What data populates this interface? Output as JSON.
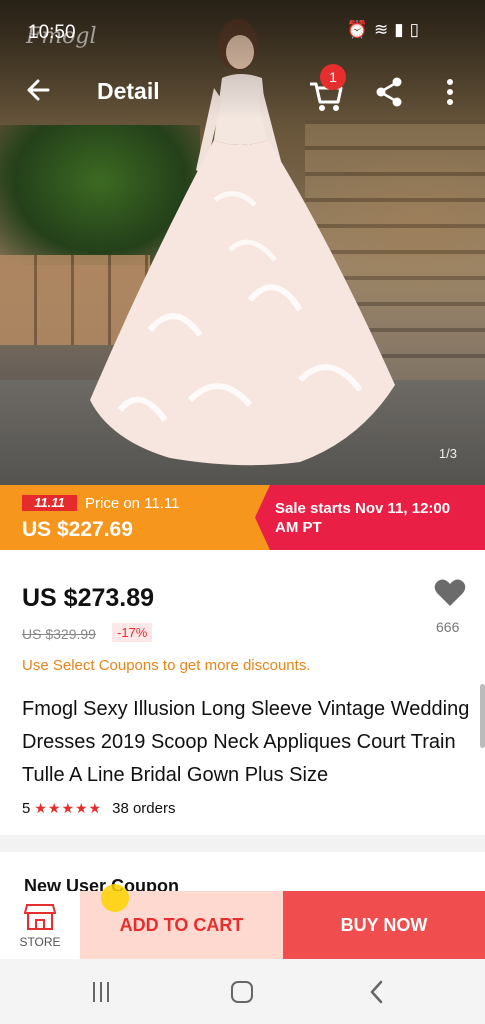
{
  "status_bar": {
    "time": "10:50",
    "brand_watermark": "Fmogl",
    "icons": [
      "alarm-icon",
      "wifi-icon",
      "signal-icon",
      "battery-icon"
    ]
  },
  "top_bar": {
    "title": "Detail",
    "cart_badge": "1"
  },
  "gallery": {
    "counter": "1/3"
  },
  "promo": {
    "tag": "11.11",
    "label": "Price on 11.11",
    "price": "US $227.69",
    "sale_text": "Sale starts Nov 11, 12:00 AM PT"
  },
  "product": {
    "price": "US $273.89",
    "old_price": "US $329.99",
    "discount": "-17%",
    "wishlist_count": "666",
    "coupon_note": "Use Select Coupons to get more discounts.",
    "name": "Fmogl Sexy Illusion Long Sleeve Vintage Wedding Dresses 2019 Scoop Neck Appliques Court Train Tulle A Line Bridal Gown Plus Size",
    "rating": "5",
    "stars": "★★★★★",
    "orders": "38 orders"
  },
  "coupon_section": {
    "heading": "New User Coupon"
  },
  "actions": {
    "store_label": "STORE",
    "add_to_cart": "ADD TO CART",
    "buy_now": "BUY NOW"
  },
  "colors": {
    "accent": "#e62e2e",
    "promo_orange": "#f6961c",
    "promo_red": "#ea1f45",
    "buy_now": "#f04e4e",
    "add_to_cart_bg": "#fdd9d0"
  }
}
